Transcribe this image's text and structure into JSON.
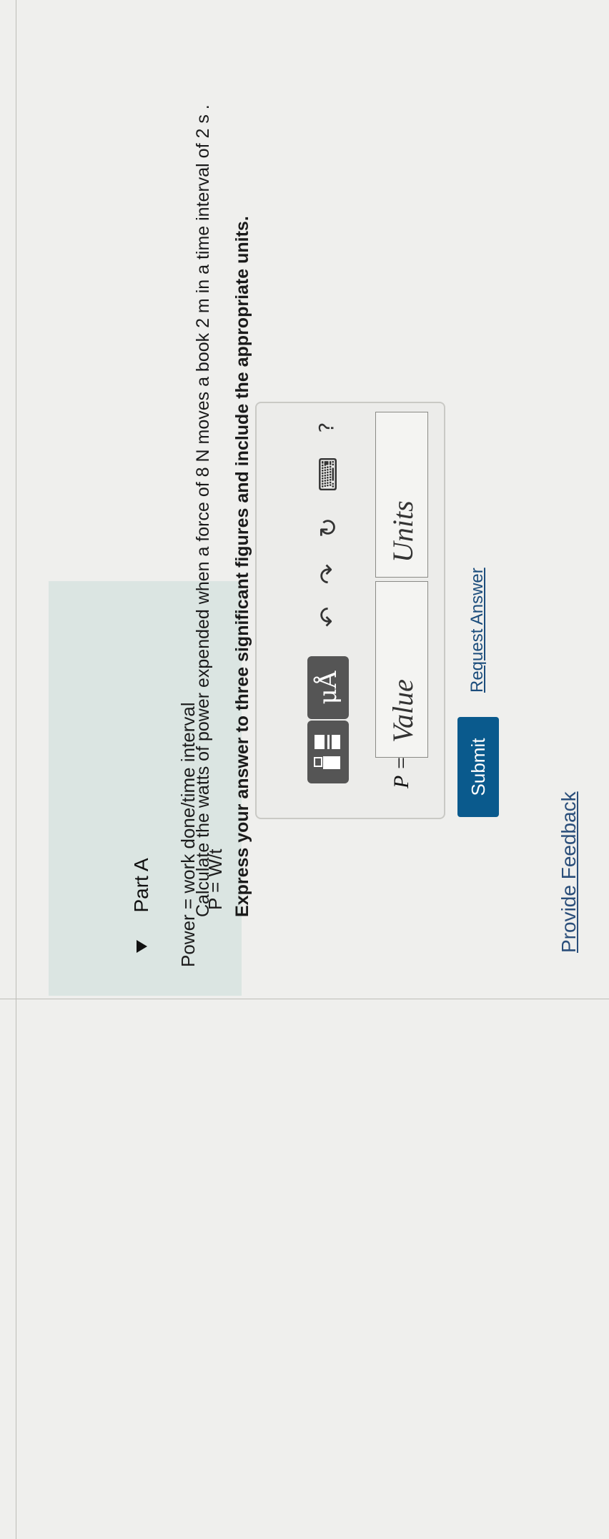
{
  "hint": {
    "line1": "Power = work done/time interval",
    "line2": "P = W/t"
  },
  "part": {
    "title": "Part A",
    "question": "Calculate the watts of power expended when a force of 8 N moves a book 2 m in a time interval of 2 s .",
    "instruction": "Express your answer to three significant figures and include the appropriate units."
  },
  "toolbar": {
    "units_symbol": "μÅ",
    "undo_icon": "↶",
    "redo_icon": "↷",
    "reset_icon": "↻",
    "keyboard_icon": "⌨",
    "help_label": "?"
  },
  "answer": {
    "variable_label": "P =",
    "value_placeholder": "Value",
    "units_placeholder": "Units"
  },
  "actions": {
    "submit_label": "Submit",
    "request_label": "Request Answer",
    "feedback_label": "Provide Feedback"
  }
}
